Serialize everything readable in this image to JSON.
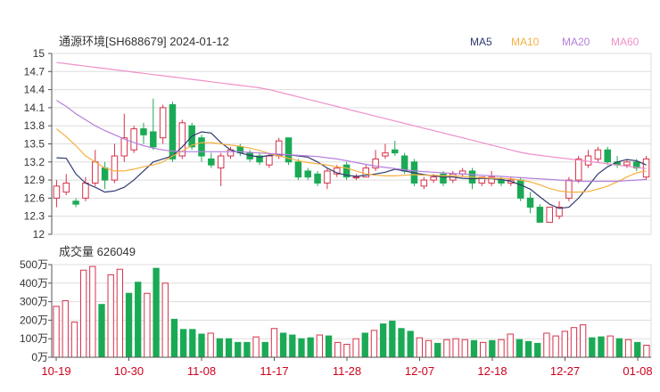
{
  "header": {
    "title": "通源环境[SH688679] 2024-01-12",
    "legend": [
      {
        "label": "MA5",
        "color": "#2e3a6e"
      },
      {
        "label": "MA10",
        "color": "#f5b041"
      },
      {
        "label": "MA20",
        "color": "#b57edc"
      },
      {
        "label": "MA60",
        "color": "#f08fc8"
      }
    ]
  },
  "colors": {
    "up": "#d6324a",
    "down": "#1aaa55",
    "grid": "#dddddd",
    "axis": "#555555"
  },
  "chart_data": [
    {
      "type": "candlestick",
      "title": "通源环境[SH688679] 2024-01-12",
      "ylim": [
        12,
        15
      ],
      "yticks": [
        "15",
        "14.7",
        "14.4",
        "14.1",
        "13.8",
        "13.5",
        "13.2",
        "12.9",
        "12.6",
        "12.3",
        "12"
      ],
      "yticks_values": [
        15,
        14.7,
        14.4,
        14.1,
        13.8,
        13.5,
        13.2,
        12.9,
        12.6,
        12.3,
        12
      ],
      "candles": [
        {
          "o": 12.6,
          "c": 12.8,
          "h": 12.9,
          "l": 12.45,
          "up": true
        },
        {
          "o": 12.7,
          "c": 12.85,
          "h": 13.0,
          "l": 12.65,
          "up": true
        },
        {
          "o": 12.55,
          "c": 12.5,
          "h": 12.6,
          "l": 12.45,
          "up": false
        },
        {
          "o": 12.6,
          "c": 12.85,
          "h": 12.95,
          "l": 12.55,
          "up": true
        },
        {
          "o": 12.85,
          "c": 13.2,
          "h": 13.4,
          "l": 12.8,
          "up": true
        },
        {
          "o": 13.1,
          "c": 12.9,
          "h": 13.2,
          "l": 12.75,
          "up": false
        },
        {
          "o": 12.9,
          "c": 13.3,
          "h": 13.5,
          "l": 12.85,
          "up": true
        },
        {
          "o": 13.3,
          "c": 13.6,
          "h": 14.0,
          "l": 13.2,
          "up": true
        },
        {
          "o": 13.4,
          "c": 13.75,
          "h": 13.8,
          "l": 13.35,
          "up": true
        },
        {
          "o": 13.75,
          "c": 13.65,
          "h": 13.85,
          "l": 13.5,
          "up": false
        },
        {
          "o": 13.7,
          "c": 13.45,
          "h": 14.25,
          "l": 13.4,
          "up": false
        },
        {
          "o": 13.6,
          "c": 14.1,
          "h": 14.15,
          "l": 13.5,
          "up": true
        },
        {
          "o": 14.15,
          "c": 13.25,
          "h": 14.2,
          "l": 13.2,
          "up": false
        },
        {
          "o": 13.3,
          "c": 13.85,
          "h": 13.9,
          "l": 13.25,
          "up": true
        },
        {
          "o": 13.8,
          "c": 13.45,
          "h": 13.85,
          "l": 13.4,
          "up": false
        },
        {
          "o": 13.6,
          "c": 13.3,
          "h": 13.65,
          "l": 13.2,
          "up": false
        },
        {
          "o": 13.25,
          "c": 13.15,
          "h": 13.35,
          "l": 13.1,
          "up": false
        },
        {
          "o": 13.1,
          "c": 13.3,
          "h": 13.35,
          "l": 12.8,
          "up": true
        },
        {
          "o": 13.3,
          "c": 13.4,
          "h": 13.45,
          "l": 13.25,
          "up": true
        },
        {
          "o": 13.45,
          "c": 13.35,
          "h": 13.5,
          "l": 13.3,
          "up": false
        },
        {
          "o": 13.35,
          "c": 13.25,
          "h": 13.4,
          "l": 13.2,
          "up": false
        },
        {
          "o": 13.3,
          "c": 13.2,
          "h": 13.35,
          "l": 13.15,
          "up": false
        },
        {
          "o": 13.15,
          "c": 13.3,
          "h": 13.35,
          "l": 13.1,
          "up": true
        },
        {
          "o": 13.3,
          "c": 13.55,
          "h": 13.6,
          "l": 13.25,
          "up": true
        },
        {
          "o": 13.6,
          "c": 13.2,
          "h": 13.6,
          "l": 13.15,
          "up": false
        },
        {
          "o": 13.2,
          "c": 12.95,
          "h": 13.25,
          "l": 12.9,
          "up": false
        },
        {
          "o": 13.05,
          "c": 12.95,
          "h": 13.1,
          "l": 12.9,
          "up": false
        },
        {
          "o": 13.0,
          "c": 12.85,
          "h": 13.05,
          "l": 12.8,
          "up": false
        },
        {
          "o": 12.85,
          "c": 13.05,
          "h": 13.1,
          "l": 12.75,
          "up": true
        },
        {
          "o": 13.0,
          "c": 13.1,
          "h": 13.15,
          "l": 12.95,
          "up": true
        },
        {
          "o": 13.15,
          "c": 12.95,
          "h": 13.2,
          "l": 12.9,
          "up": false
        },
        {
          "o": 12.95,
          "c": 12.95,
          "h": 13.0,
          "l": 12.9,
          "up": true
        },
        {
          "o": 12.95,
          "c": 13.1,
          "h": 13.15,
          "l": 12.95,
          "up": true
        },
        {
          "o": 13.1,
          "c": 13.25,
          "h": 13.4,
          "l": 13.05,
          "up": true
        },
        {
          "o": 13.3,
          "c": 13.35,
          "h": 13.5,
          "l": 13.25,
          "up": true
        },
        {
          "o": 13.4,
          "c": 13.35,
          "h": 13.55,
          "l": 13.3,
          "up": false
        },
        {
          "o": 13.3,
          "c": 13.05,
          "h": 13.35,
          "l": 13.0,
          "up": false
        },
        {
          "o": 13.2,
          "c": 12.85,
          "h": 13.25,
          "l": 12.8,
          "up": false
        },
        {
          "o": 12.8,
          "c": 12.9,
          "h": 12.95,
          "l": 12.75,
          "up": true
        },
        {
          "o": 12.9,
          "c": 12.95,
          "h": 13.0,
          "l": 12.85,
          "up": true
        },
        {
          "o": 13.0,
          "c": 12.85,
          "h": 13.05,
          "l": 12.8,
          "up": false
        },
        {
          "o": 12.9,
          "c": 13.0,
          "h": 13.05,
          "l": 12.85,
          "up": true
        },
        {
          "o": 13.0,
          "c": 13.05,
          "h": 13.1,
          "l": 12.95,
          "up": true
        },
        {
          "o": 13.05,
          "c": 12.85,
          "h": 13.1,
          "l": 12.75,
          "up": false
        },
        {
          "o": 12.85,
          "c": 12.95,
          "h": 12.95,
          "l": 12.8,
          "up": true
        },
        {
          "o": 12.85,
          "c": 12.95,
          "h": 13.05,
          "l": 12.8,
          "up": true
        },
        {
          "o": 12.9,
          "c": 12.85,
          "h": 12.95,
          "l": 12.8,
          "up": false
        },
        {
          "o": 12.85,
          "c": 12.9,
          "h": 12.95,
          "l": 12.8,
          "up": true
        },
        {
          "o": 12.9,
          "c": 12.6,
          "h": 12.95,
          "l": 12.55,
          "up": false
        },
        {
          "o": 12.6,
          "c": 12.45,
          "h": 12.7,
          "l": 12.35,
          "up": false
        },
        {
          "o": 12.45,
          "c": 12.2,
          "h": 12.5,
          "l": 12.2,
          "up": false
        },
        {
          "o": 12.2,
          "c": 12.45,
          "h": 12.45,
          "l": 12.2,
          "up": true
        },
        {
          "o": 12.3,
          "c": 12.45,
          "h": 12.55,
          "l": 12.25,
          "up": true
        },
        {
          "o": 12.6,
          "c": 12.9,
          "h": 12.95,
          "l": 12.55,
          "up": true
        },
        {
          "o": 12.9,
          "c": 13.25,
          "h": 13.3,
          "l": 12.85,
          "up": true
        },
        {
          "o": 13.15,
          "c": 13.3,
          "h": 13.4,
          "l": 13.1,
          "up": true
        },
        {
          "o": 13.25,
          "c": 13.4,
          "h": 13.45,
          "l": 13.2,
          "up": true
        },
        {
          "o": 13.4,
          "c": 13.2,
          "h": 13.45,
          "l": 13.15,
          "up": false
        },
        {
          "o": 13.2,
          "c": 13.15,
          "h": 13.3,
          "l": 13.1,
          "up": false
        },
        {
          "o": 13.15,
          "c": 13.2,
          "h": 13.25,
          "l": 13.1,
          "up": true
        },
        {
          "o": 13.2,
          "c": 13.1,
          "h": 13.25,
          "l": 13.05,
          "up": false
        },
        {
          "o": 12.95,
          "c": 13.25,
          "h": 13.3,
          "l": 12.9,
          "up": true
        }
      ],
      "ma": {
        "MA5": [
          13.27,
          13.26,
          13.0,
          12.85,
          12.78,
          12.7,
          12.72,
          12.78,
          12.9,
          13.05,
          13.2,
          13.25,
          13.3,
          13.45,
          13.63,
          13.7,
          13.68,
          13.52,
          13.4,
          13.35,
          13.31,
          13.28,
          13.31,
          13.32,
          13.32,
          13.3,
          13.28,
          13.2,
          13.1,
          13.02,
          12.98,
          12.96,
          12.98,
          13.0,
          13.03,
          13.08,
          13.05,
          13.02,
          12.99,
          12.97,
          12.95,
          12.95,
          12.93,
          12.92,
          12.93,
          12.92,
          12.91,
          12.88,
          12.82,
          12.75,
          12.62,
          12.5,
          12.43,
          12.45,
          12.6,
          12.8,
          13.0,
          13.12,
          13.2,
          13.24,
          13.22,
          13.15
        ],
        "MA10": [
          13.75,
          13.62,
          13.47,
          13.3,
          13.2,
          13.1,
          13.05,
          13.05,
          13.08,
          13.12,
          13.15,
          13.2,
          13.3,
          13.38,
          13.48,
          13.52,
          13.52,
          13.5,
          13.48,
          13.46,
          13.43,
          13.39,
          13.34,
          13.3,
          13.26,
          13.22,
          13.19,
          13.17,
          13.15,
          13.12,
          13.1,
          13.05,
          13.0,
          12.98,
          12.97,
          12.97,
          12.98,
          12.99,
          12.98,
          12.98,
          12.97,
          12.97,
          12.96,
          12.95,
          12.94,
          12.93,
          12.93,
          12.92,
          12.9,
          12.87,
          12.82,
          12.76,
          12.72,
          12.7,
          12.7,
          12.71,
          12.75,
          12.8,
          12.87,
          12.95,
          13.02,
          13.05
        ],
        "MA20": [
          14.22,
          14.12,
          14.0,
          13.9,
          13.8,
          13.72,
          13.65,
          13.58,
          13.52,
          13.47,
          13.43,
          13.4,
          13.38,
          13.37,
          13.37,
          13.37,
          13.37,
          13.37,
          13.37,
          13.37,
          13.36,
          13.35,
          13.34,
          13.33,
          13.32,
          13.31,
          13.3,
          13.29,
          13.27,
          13.25,
          13.22,
          13.19,
          13.16,
          13.13,
          13.11,
          13.09,
          13.07,
          13.05,
          13.04,
          13.03,
          13.02,
          13.01,
          13.0,
          12.99,
          12.98,
          12.97,
          12.96,
          12.95,
          12.94,
          12.93,
          12.92,
          12.91,
          12.9,
          12.89,
          12.88,
          12.88,
          12.88,
          12.88,
          12.88,
          12.89,
          12.9,
          12.91
        ],
        "MA60": [
          14.85,
          14.83,
          14.81,
          14.79,
          14.77,
          14.75,
          14.73,
          14.71,
          14.69,
          14.67,
          14.65,
          14.63,
          14.61,
          14.59,
          14.57,
          14.55,
          14.53,
          14.51,
          14.49,
          14.47,
          14.45,
          14.43,
          14.4,
          14.36,
          14.32,
          14.28,
          14.24,
          14.2,
          14.16,
          14.12,
          14.08,
          14.04,
          14.0,
          13.96,
          13.92,
          13.88,
          13.84,
          13.8,
          13.76,
          13.72,
          13.68,
          13.64,
          13.6,
          13.56,
          13.52,
          13.48,
          13.44,
          13.4,
          13.36,
          13.33,
          13.31,
          13.29,
          13.27,
          13.25,
          13.23,
          13.21,
          13.19,
          13.17,
          13.15,
          13.13,
          13.11,
          13.09
        ]
      }
    },
    {
      "type": "bar",
      "title": "成交量 626049",
      "ylim": [
        0,
        500
      ],
      "yticks": [
        "500万",
        "400万",
        "300万",
        "200万",
        "100万",
        "0万"
      ],
      "yticks_values": [
        500,
        400,
        300,
        200,
        100,
        0
      ],
      "unit": "万",
      "values": [
        275,
        305,
        190,
        470,
        490,
        285,
        445,
        475,
        345,
        405,
        345,
        480,
        400,
        205,
        150,
        150,
        125,
        130,
        100,
        100,
        80,
        80,
        110,
        80,
        155,
        130,
        120,
        100,
        105,
        120,
        115,
        80,
        70,
        100,
        130,
        145,
        180,
        195,
        155,
        140,
        105,
        90,
        75,
        95,
        100,
        95,
        90,
        80,
        90,
        95,
        125,
        95,
        85,
        75,
        130,
        115,
        140,
        160,
        175,
        105,
        110,
        115,
        100,
        95,
        80,
        65
      ],
      "up": [
        true,
        true,
        true,
        true,
        true,
        false,
        true,
        true,
        false,
        false,
        true,
        false,
        true,
        false,
        false,
        false,
        false,
        true,
        false,
        false,
        false,
        false,
        true,
        false,
        true,
        false,
        false,
        false,
        false,
        true,
        false,
        true,
        true,
        true,
        false,
        true,
        false,
        false,
        false,
        false,
        true,
        true,
        false,
        true,
        true,
        true,
        false,
        true,
        false,
        true,
        true,
        false,
        false,
        false,
        true,
        true,
        true,
        true,
        true,
        false,
        false,
        true,
        false,
        true,
        false,
        true
      ],
      "categories": [
        "10-19",
        "10-30",
        "11-08",
        "11-17",
        "11-28",
        "12-07",
        "12-18",
        "12-27",
        "01-08"
      ]
    }
  ]
}
